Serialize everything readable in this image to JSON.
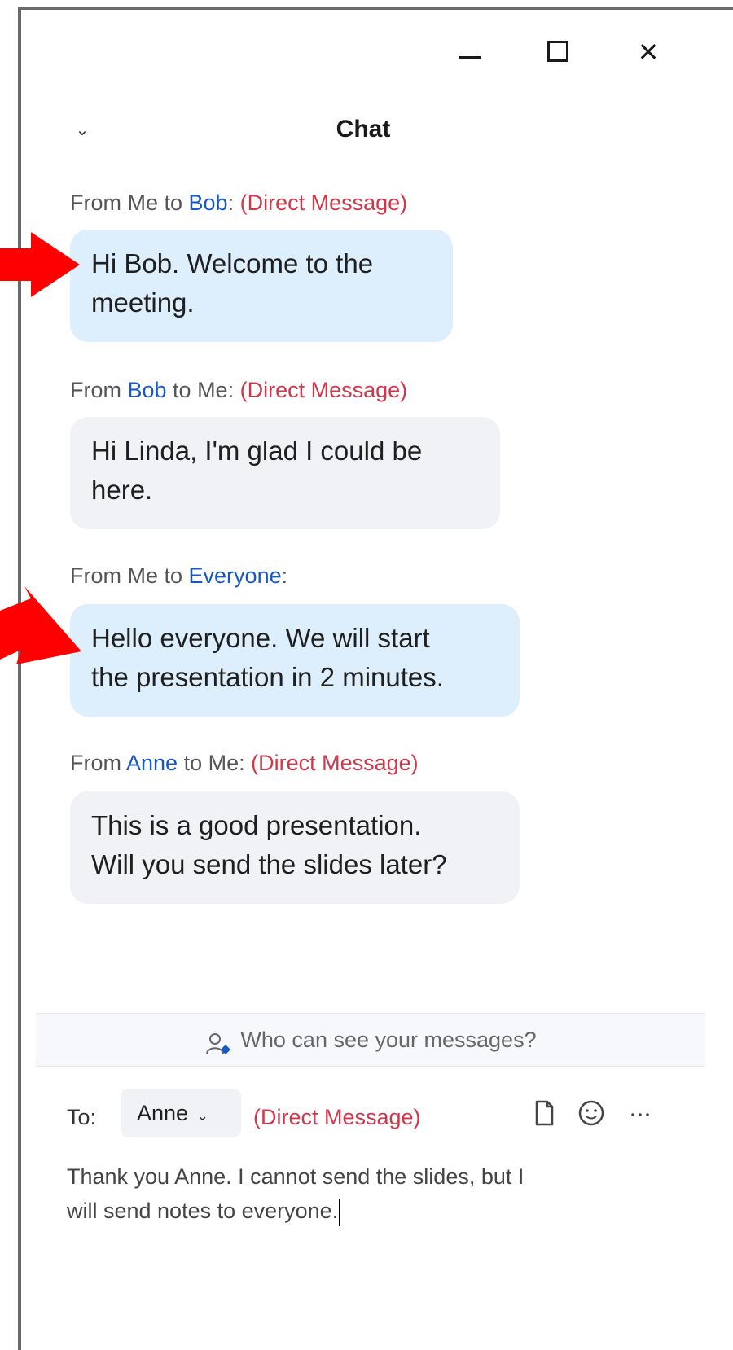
{
  "window": {
    "title": "Chat"
  },
  "messages": [
    {
      "header_prefix": "From Me to ",
      "header_name": "Bob",
      "header_suffix": ":",
      "tag": "(Direct Message)",
      "text_lines": [
        "Hi Bob.  Welcome to the",
        "meeting."
      ],
      "sender": "me"
    },
    {
      "header_prefix": "From ",
      "header_name": "Bob",
      "header_suffix": " to Me:",
      "tag": "(Direct Message)",
      "text_lines": [
        "Hi Linda, I'm glad I could be",
        "here."
      ],
      "sender": "other"
    },
    {
      "header_prefix": "From Me to ",
      "header_name": "Everyone",
      "header_suffix": ":",
      "tag": "",
      "text_lines": [
        "Hello everyone.  We will start",
        "the presentation in 2 minutes."
      ],
      "sender": "me"
    },
    {
      "header_prefix": "From ",
      "header_name": "Anne",
      "header_suffix": " to Me:",
      "tag": "(Direct Message)",
      "text_lines": [
        "This is a good presentation.",
        "Will you send the slides later?"
      ],
      "sender": "other"
    }
  ],
  "visibility_text": "Who can see your messages?",
  "composer": {
    "to_label": "To:",
    "recipient": "Anne",
    "tag": "(Direct Message)",
    "draft_lines": [
      "Thank you Anne.  I cannot send the slides, but I",
      "will send notes to everyone."
    ]
  },
  "icons": {
    "minimize": "minimize-icon",
    "maximize": "maximize-icon",
    "close": "close-icon",
    "collapse": "chevron-down-icon",
    "visibility": "person-icon",
    "file": "file-icon",
    "emoji": "emoji-icon",
    "more": "more-icon",
    "arrow": "red-arrow-annotation"
  },
  "colors": {
    "me_bubble": "#ddeefc",
    "other_bubble": "#f1f2f5",
    "name": "#1857c6",
    "direct_message": "#d0374a",
    "arrow": "#ff0000"
  }
}
